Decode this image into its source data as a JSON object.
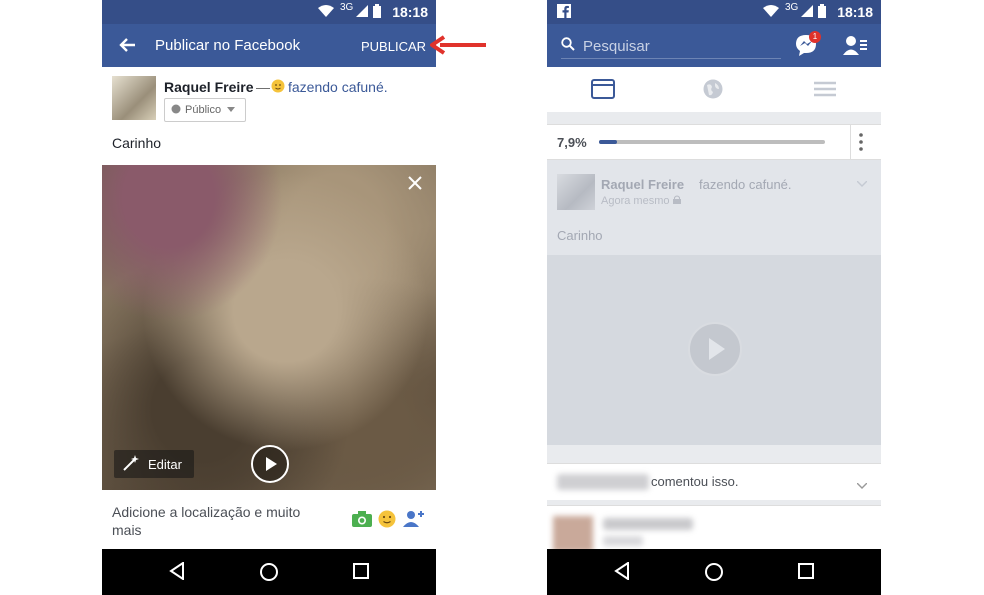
{
  "left": {
    "status": {
      "network": "3G",
      "time": "18:18"
    },
    "header": {
      "title": "Publicar no Facebook",
      "publish_label": "PUBLICAR"
    },
    "post": {
      "author": "Raquel Freire",
      "separator": "—",
      "feeling": "fazendo cafuné.",
      "privacy": "Público",
      "caption": "Carinho",
      "edit_label": "Editar"
    },
    "footer": {
      "location_prompt": "Adicione a localização e muito mais"
    }
  },
  "right": {
    "status": {
      "network": "3G",
      "time": "18:18"
    },
    "search": {
      "placeholder": "Pesquisar",
      "messenger_badge": "1"
    },
    "upload": {
      "percent_label": "7,9%",
      "progress": 0.079
    },
    "post": {
      "author": "Raquel Freire",
      "feeling": "fazendo cafuné.",
      "time": "Agora mesmo",
      "caption": "Carinho"
    },
    "activity": {
      "comment_text": "comentou isso."
    }
  },
  "colors": {
    "facebook_blue": "#3b5998",
    "status_blue": "#354e88",
    "annotation_red": "#e0322b"
  }
}
